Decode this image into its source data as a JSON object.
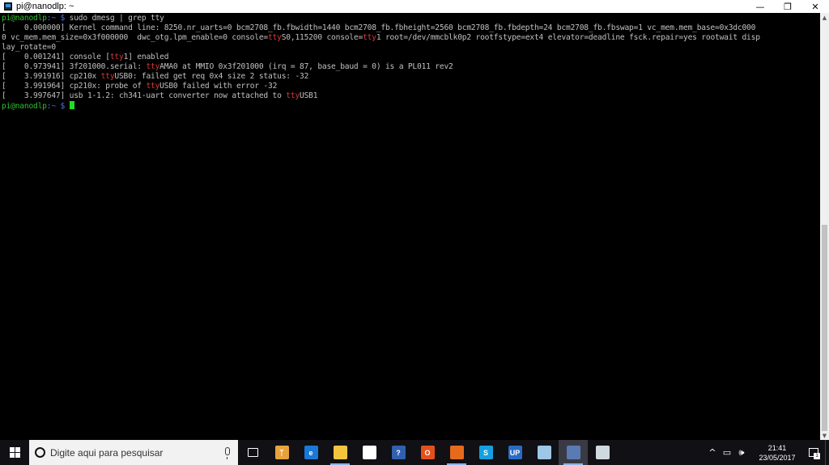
{
  "window": {
    "title": "pi@nanodlp: ~",
    "controls": {
      "minimize": "—",
      "restore": "❐",
      "close": "✕"
    }
  },
  "terminal": {
    "lines": [
      [
        {
          "t": "pi@nanodlp",
          "c": "g"
        },
        {
          "t": ":~ $ ",
          "c": "b"
        },
        {
          "t": "sudo dmesg | grep tty",
          "c": "w"
        }
      ],
      [
        {
          "t": "[    0.000000] Kernel command line: 8250.nr_uarts=0 bcm2708_fb.fbwidth=1440 bcm2708_fb.fbheight=2560 bcm2708_fb.fbdepth=24 bcm2708_fb.fbswap=1 vc_mem.mem_base=0x3dc000",
          "c": "w"
        }
      ],
      [
        {
          "t": "0 vc_mem.mem_size=0x3f000000  dwc_otg.lpm_enable=0 console=",
          "c": "w"
        },
        {
          "t": "tty",
          "c": "r"
        },
        {
          "t": "S0,115200 console=",
          "c": "w"
        },
        {
          "t": "tty",
          "c": "r"
        },
        {
          "t": "1 root=/dev/mmcblk0p2 rootfstype=ext4 elevator=deadline fsck.repair=yes rootwait disp",
          "c": "w"
        }
      ],
      [
        {
          "t": "lay_rotate=0",
          "c": "w"
        }
      ],
      [
        {
          "t": "[    0.001241] console [",
          "c": "w"
        },
        {
          "t": "tty",
          "c": "r"
        },
        {
          "t": "1] enabled",
          "c": "w"
        }
      ],
      [
        {
          "t": "[    0.973941] 3f201000.serial: ",
          "c": "w"
        },
        {
          "t": "tty",
          "c": "r"
        },
        {
          "t": "AMA0 at MMIO 0x3f201000 (irq = 87, base_baud = 0) is a PL011 rev2",
          "c": "w"
        }
      ],
      [
        {
          "t": "[    3.991916] cp210x ",
          "c": "w"
        },
        {
          "t": "tty",
          "c": "r"
        },
        {
          "t": "USB0: failed get req 0x4 size 2 status: -32",
          "c": "w"
        }
      ],
      [
        {
          "t": "[    3.991964] cp210x: probe of ",
          "c": "w"
        },
        {
          "t": "tty",
          "c": "r"
        },
        {
          "t": "USB0 failed with error -32",
          "c": "w"
        }
      ],
      [
        {
          "t": "[    3.997647] usb 1-1.2: ch341-uart converter now attached to ",
          "c": "w"
        },
        {
          "t": "tty",
          "c": "r"
        },
        {
          "t": "USB1",
          "c": "w"
        }
      ],
      [
        {
          "t": "pi@nanodlp",
          "c": "g"
        },
        {
          "t": ":~ $ ",
          "c": "b"
        },
        {
          "cursor": true
        }
      ]
    ]
  },
  "taskbar": {
    "search_placeholder": "Digite aqui para pesquisar",
    "apps": [
      {
        "name": "task-view",
        "label": "",
        "bg": "transparent",
        "running": false,
        "active": false
      },
      {
        "name": "recycle-app",
        "label": "ᛉ",
        "bg": "#e8a23a",
        "running": false,
        "active": false
      },
      {
        "name": "edge",
        "label": "e",
        "bg": "#1a78d6",
        "running": false,
        "active": false
      },
      {
        "name": "file-explorer",
        "label": "",
        "bg": "#f2c53d",
        "running": true,
        "active": false
      },
      {
        "name": "store",
        "label": "",
        "bg": "#ffffff",
        "running": false,
        "active": false
      },
      {
        "name": "help",
        "label": "?",
        "bg": "#3060b0",
        "running": false,
        "active": false
      },
      {
        "name": "office",
        "label": "O",
        "bg": "#e3501c",
        "running": false,
        "active": false
      },
      {
        "name": "firefox",
        "label": "",
        "bg": "#e66a1c",
        "running": true,
        "active": false
      },
      {
        "name": "skype",
        "label": "S",
        "bg": "#14a0e0",
        "running": false,
        "active": false
      },
      {
        "name": "up-app",
        "label": "UP",
        "bg": "#2a6cc4",
        "running": false,
        "active": false
      },
      {
        "name": "notes",
        "label": "",
        "bg": "#9ec6e6",
        "running": false,
        "active": false
      },
      {
        "name": "putty",
        "label": "",
        "bg": "#5a7ab4",
        "running": true,
        "active": true
      },
      {
        "name": "paint",
        "label": "",
        "bg": "#d0d8e0",
        "running": false,
        "active": false
      }
    ],
    "tray": {
      "chevron": "^",
      "battery": "▭",
      "volume": "🕪",
      "time": "21:41",
      "date": "23/05/2017",
      "notification_count": "1"
    }
  }
}
